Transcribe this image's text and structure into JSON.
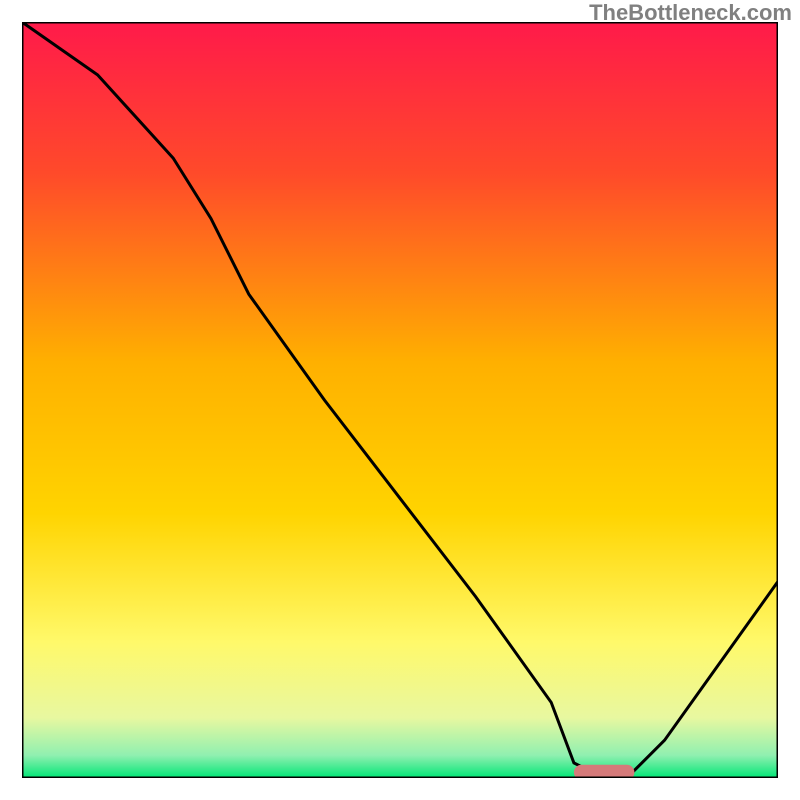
{
  "watermark": "TheBottleneck.com",
  "chart_data": {
    "type": "line",
    "title": "",
    "xlabel": "",
    "ylabel": "",
    "xlim": [
      0,
      100
    ],
    "ylim": [
      0,
      100
    ],
    "grid": false,
    "legend": false,
    "gradient_colors": {
      "top": "#ff1a4a",
      "upper_mid": "#ff6a00",
      "mid": "#ffd400",
      "lower_mid": "#f9f871",
      "low": "#d9f28c",
      "bottom": "#00e676"
    },
    "curve": {
      "x": [
        0,
        10,
        20,
        25,
        30,
        40,
        50,
        60,
        70,
        73,
        77,
        80,
        85,
        90,
        100
      ],
      "y": [
        100,
        93,
        82,
        74,
        64,
        50,
        37,
        24,
        10,
        2,
        0,
        0,
        5,
        12,
        26
      ]
    },
    "marker": {
      "x": 77,
      "y": 0,
      "width": 8,
      "height": 1.5,
      "color": "#d57a7a"
    }
  }
}
